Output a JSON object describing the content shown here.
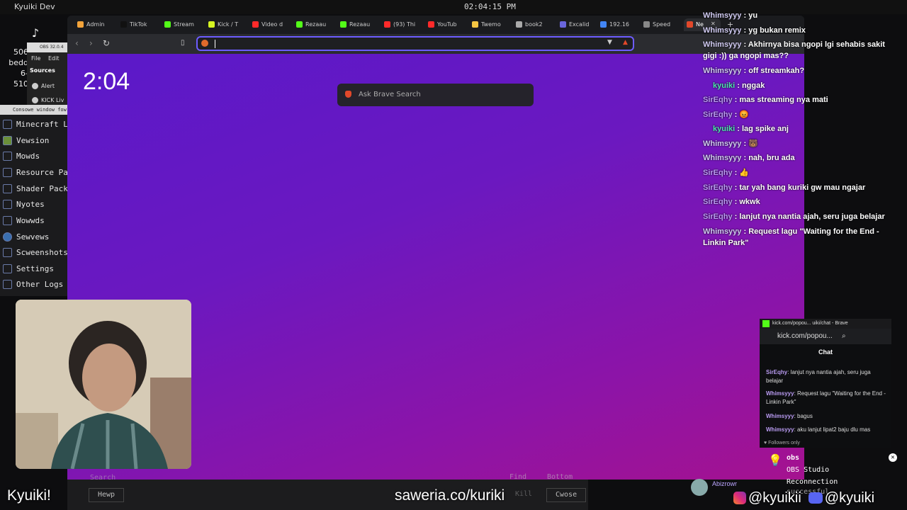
{
  "desktop": {
    "app_title": "Kyuiki Dev",
    "clock": "02:04:15 PM",
    "side_text": [
      "506",
      "bedd",
      "6-510"
    ]
  },
  "obs_mini": {
    "title": "OBS 32.0.4",
    "menu": [
      "File",
      "Edit"
    ],
    "sources_label": "Sources",
    "items": [
      "Alert",
      "KICK Liv"
    ]
  },
  "launcher": {
    "header": "Consowe window fow",
    "items": [
      "Minecraft L",
      "Vewsion",
      "Mowds",
      "Resource Pac",
      "Shader Packs",
      "Nyotes",
      "Wowwds",
      "Sewvews",
      "Scweenshots",
      "Settings",
      "Other Logs"
    ]
  },
  "browser": {
    "tabs": [
      {
        "label": "Admin",
        "color": "#f2a33a"
      },
      {
        "label": "TikTok",
        "color": "#111111"
      },
      {
        "label": "Stream",
        "color": "#53fc18"
      },
      {
        "label": "Kick / T",
        "color": "#d6f522"
      },
      {
        "label": "Video d",
        "color": "#ff2a2a"
      },
      {
        "label": "Rezaau",
        "color": "#53fc18"
      },
      {
        "label": "Rezaau",
        "color": "#53fc18"
      },
      {
        "label": "(93) Thi",
        "color": "#ff2a2a"
      },
      {
        "label": "YouTub",
        "color": "#ff2a2a"
      },
      {
        "label": "Twemo",
        "color": "#f5c542"
      },
      {
        "label": "book2",
        "color": "#aaaaaa"
      },
      {
        "label": "Excalid",
        "color": "#6965db"
      },
      {
        "label": "192.16",
        "color": "#4285f4"
      },
      {
        "label": "Speed",
        "color": "#888888"
      },
      {
        "label": "Ne",
        "color": "#e2482a"
      }
    ],
    "clock": "2:04",
    "ask_placeholder": "Ask Brave Search"
  },
  "chat_overlay": [
    {
      "user": "Whimsyyy",
      "text": " : yu"
    },
    {
      "user": "Whimsyyy",
      "text": " : yg bukan remix"
    },
    {
      "user": "Whimsyyy",
      "text": " : Akhirnya bisa ngopi lgi sehabis sakit"
    },
    {
      "user": "",
      "text": "gigi :)) ga ngopi mas??"
    },
    {
      "user": "Whimsyyy",
      "text": " : off streamkah?"
    },
    {
      "user": "kyuiki",
      "text": " : nggak"
    },
    {
      "user": "SirEqhy",
      "text": " : mas streaming nya mati"
    },
    {
      "user": "SirEqhy",
      "text": " : 😡"
    },
    {
      "user": "kyuiki",
      "text": " : lag spike anj"
    },
    {
      "user": "Whimsyyy",
      "text": " : 🐻"
    },
    {
      "user": "Whimsyyy",
      "text": " : nah, bru ada"
    },
    {
      "user": "SirEqhy",
      "text": " : 👍"
    },
    {
      "user": "SirEqhy",
      "text": " : tar yah bang kuriki gw mau ngajar"
    },
    {
      "user": "SirEqhy",
      "text": " : wkwk"
    },
    {
      "user": "SirEqhy",
      "text": " : lanjut nya nantia ajah, seru juga belajar"
    },
    {
      "user": "Whimsyyy",
      "text": " : Request lagu \"Waiting for the End -"
    },
    {
      "user": "",
      "text": "Linkin Park\""
    }
  ],
  "kick_popup": {
    "title": "kick.com/popou... uiki/chat - Brave",
    "address": "kick.com/popou...",
    "chat_label": "Chat",
    "messages": [
      {
        "user": "SirEqhy",
        "text": ": lanjut nya nantia ajah, seru juga belajar"
      },
      {
        "user": "Whimsyyy",
        "text": ": Request lagu \"Waiting for the End - Linkin Park\""
      },
      {
        "user": "Whimsyyy",
        "text": ": bagus"
      },
      {
        "user": "Whimsyyy",
        "text": ": aku lanjut lipat2 baju dlu mas"
      }
    ],
    "followers_only": "Followers only"
  },
  "notification": {
    "app": "obs",
    "lines": [
      "OBS Studio",
      "Reconnection",
      "successful"
    ]
  },
  "bottom": {
    "search_placeholder": "Search",
    "find_label": "Find",
    "bottom_label": "Bottom",
    "help_label": "Hewp",
    "close_label": "Cwose",
    "kill_label": "Kill"
  },
  "streamer_name": "Abizrowr",
  "overlay": {
    "name": "Kyuiki!",
    "saweria": "saweria.co/kuriki",
    "instagram": "@kyuikii",
    "discord": "@kyuiki"
  }
}
